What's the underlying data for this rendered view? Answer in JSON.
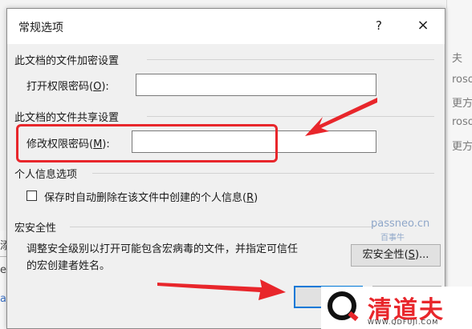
{
  "dialog": {
    "title": "常规选项",
    "help": "?",
    "close": "×"
  },
  "encryption": {
    "heading": "此文档的文件加密设置",
    "open_password_label": "打开权限密码(",
    "open_password_key": "O",
    "open_password_end": "):",
    "open_password_value": ""
  },
  "sharing": {
    "heading": "此文档的文件共享设置",
    "modify_password_label": "修改权限密码(",
    "modify_password_key": "M",
    "modify_password_end": "):",
    "modify_password_value": ""
  },
  "privacy": {
    "heading": "个人信息选项",
    "remove_info_label": "保存时自动删除在该文件中创建的个人信息(",
    "remove_info_key": "R",
    "remove_info_end": ")",
    "checked": false
  },
  "macro": {
    "heading": "宏安全性",
    "description_line1": "调整安全级别以打开可能包含宏病毒的文件，并指定可信任",
    "description_line2": "的宏创建者姓名。",
    "button_label": "宏安全性(",
    "button_key": "S",
    "button_end": ")..."
  },
  "background": {
    "right_texts": [
      "夫",
      "roso",
      "更方式",
      "roso",
      "更方式"
    ],
    "left_texts": [
      "添",
      "er",
      "aP"
    ]
  },
  "watermark": {
    "site": "passneo.cn",
    "sub": "百事牛"
  },
  "logo": {
    "name": "清道夫",
    "url": "WWW.QDFUJI.COM"
  },
  "colors": {
    "highlight": "#e8262b"
  }
}
